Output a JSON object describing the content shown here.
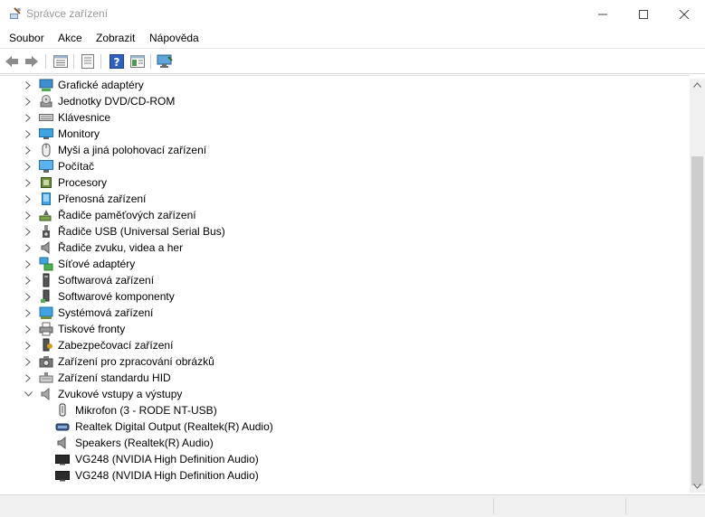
{
  "window": {
    "title": "Správce zařízení"
  },
  "menu": [
    "Soubor",
    "Akce",
    "Zobrazit",
    "Nápověda"
  ],
  "toolbar": [
    {
      "icon": "back-icon"
    },
    {
      "icon": "forward-icon"
    },
    {
      "icon": "properties-list-icon"
    },
    {
      "icon": "document-icon"
    },
    {
      "icon": "help-icon"
    },
    {
      "icon": "panel-icon"
    },
    {
      "icon": "monitor-scan-icon"
    }
  ],
  "tree": {
    "categories": [
      {
        "label": "Grafické adaptéry",
        "icon": "display-adapter-icon"
      },
      {
        "label": "Jednotky DVD/CD-ROM",
        "icon": "dvd-drive-icon"
      },
      {
        "label": "Klávesnice",
        "icon": "keyboard-icon"
      },
      {
        "label": "Monitory",
        "icon": "monitor-icon"
      },
      {
        "label": "Myši a jiná polohovací zařízení",
        "icon": "mouse-icon"
      },
      {
        "label": "Počítač",
        "icon": "computer-icon"
      },
      {
        "label": "Procesory",
        "icon": "processor-icon"
      },
      {
        "label": "Přenosná zařízení",
        "icon": "portable-device-icon"
      },
      {
        "label": "Řadiče paměťových zařízení",
        "icon": "storage-controller-icon"
      },
      {
        "label": "Řadiče USB (Universal Serial Bus)",
        "icon": "usb-icon"
      },
      {
        "label": "Řadiče zvuku, videa a her",
        "icon": "speaker-icon"
      },
      {
        "label": "Síťové adaptéry",
        "icon": "network-adapter-icon"
      },
      {
        "label": "Softwarová zařízení",
        "icon": "software-device-icon"
      },
      {
        "label": "Softwarové komponenty",
        "icon": "software-component-icon"
      },
      {
        "label": "Systémová zařízení",
        "icon": "system-device-icon"
      },
      {
        "label": "Tiskové fronty",
        "icon": "printer-icon"
      },
      {
        "label": "Zabezpečovací zařízení",
        "icon": "security-device-icon"
      },
      {
        "label": "Zařízení pro zpracování obrázků",
        "icon": "camera-icon"
      },
      {
        "label": "Zařízení standardu HID",
        "icon": "hid-icon"
      },
      {
        "label": "Zvukové vstupy a výstupy",
        "icon": "audio-io-icon",
        "expanded": true
      }
    ],
    "audio_children": [
      {
        "label": "Mikrofon (3 - RODE NT-USB)",
        "icon": "microphone-icon"
      },
      {
        "label": "Realtek Digital Output (Realtek(R) Audio)",
        "icon": "digital-output-icon"
      },
      {
        "label": "Speakers (Realtek(R) Audio)",
        "icon": "speaker-icon"
      },
      {
        "label": "VG248 (NVIDIA High Definition Audio)",
        "icon": "monitor-audio-icon"
      },
      {
        "label": "VG248 (NVIDIA High Definition Audio)",
        "icon": "monitor-audio-icon"
      }
    ]
  }
}
